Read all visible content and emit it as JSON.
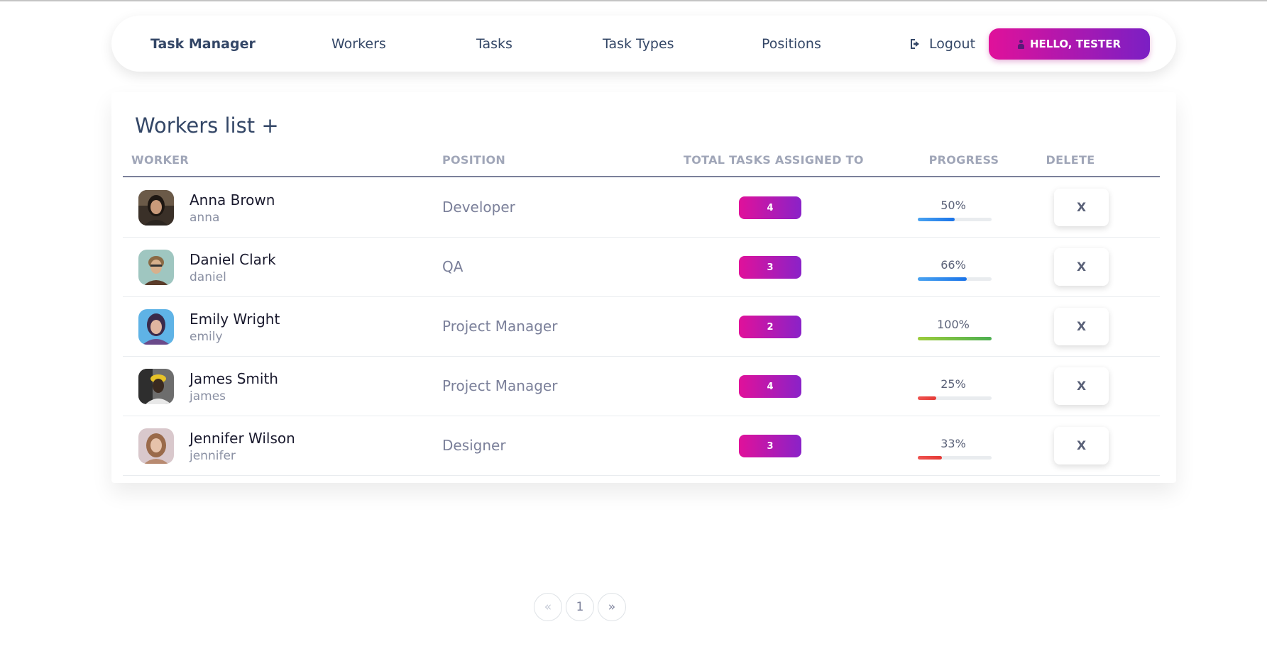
{
  "nav": {
    "brand": "Task Manager",
    "links": [
      "Workers",
      "Tasks",
      "Task Types",
      "Positions"
    ],
    "logout": "Logout",
    "user_button": "HELLO, TESTER"
  },
  "card": {
    "title": "Workers list",
    "add_symbol": "+"
  },
  "table": {
    "headers": {
      "worker": "WORKER",
      "position": "POSITION",
      "total_tasks": "TOTAL TASKS ASSIGNED TO",
      "progress": "PROGRESS",
      "delete": "DELETE"
    },
    "rows": [
      {
        "name": "Anna Brown",
        "username": "anna",
        "position": "Developer",
        "tasks": "4",
        "progress_label": "50%",
        "progress": 50,
        "color": "blue"
      },
      {
        "name": "Daniel Clark",
        "username": "daniel",
        "position": "QA",
        "tasks": "3",
        "progress_label": "66%",
        "progress": 66,
        "color": "blue"
      },
      {
        "name": "Emily Wright",
        "username": "emily",
        "position": "Project Manager",
        "tasks": "2",
        "progress_label": "100%",
        "progress": 100,
        "color": "green"
      },
      {
        "name": "James Smith",
        "username": "james",
        "position": "Project Manager",
        "tasks": "4",
        "progress_label": "25%",
        "progress": 25,
        "color": "red"
      },
      {
        "name": "Jennifer Wilson",
        "username": "jennifer",
        "position": "Designer",
        "tasks": "3",
        "progress_label": "33%",
        "progress": 33,
        "color": "red"
      }
    ],
    "delete_label": "X"
  },
  "pagination": {
    "prev": "«",
    "current": "1",
    "next": "»"
  },
  "colors": {
    "accent_start": "#e0119a",
    "accent_end": "#7b1fc4",
    "text_dark": "#344767",
    "text_muted": "#7b809a"
  }
}
